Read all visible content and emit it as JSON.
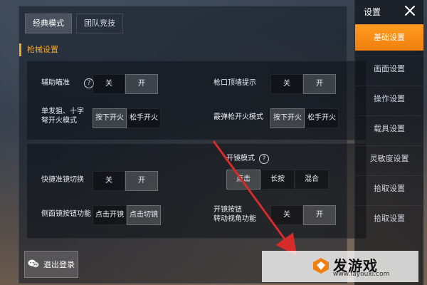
{
  "tabs": [
    {
      "label": "经典模式"
    },
    {
      "label": "团队竞技"
    }
  ],
  "section": {
    "title": "枪械设置"
  },
  "panel1": {
    "rows": [
      {
        "label": "辅助瞄准",
        "options": [
          "关",
          "开"
        ]
      },
      {
        "label": "枪口顶墙提示",
        "options": [
          "关",
          "开"
        ]
      },
      {
        "label": "单发狙、十字\n弩开火模式",
        "options": [
          "按下开火",
          "松手开火"
        ]
      },
      {
        "label": "霰弹枪开火模式",
        "options": [
          "按下开火",
          "松手开火"
        ]
      }
    ]
  },
  "panel2": {
    "rows": [
      {
        "label": "快捷准镜切换",
        "options": [
          "关",
          "开"
        ]
      },
      {
        "label": "开镜模式",
        "options": [
          "点击",
          "长按",
          "混合"
        ]
      },
      {
        "label": "侧面镜按钮功能",
        "options": [
          "点击开镜",
          "点击切镜"
        ]
      },
      {
        "label": "开镜按钮\n转动视角功能",
        "options": [
          "关",
          "开"
        ]
      }
    ]
  },
  "sidebar": {
    "title": "设置",
    "items": [
      {
        "label": "基础设置"
      },
      {
        "label": "画面设置"
      },
      {
        "label": "操作设置"
      },
      {
        "label": "载具设置"
      },
      {
        "label": "灵敏度设置"
      },
      {
        "label": "拾取设置"
      },
      {
        "label": "拾取设置"
      }
    ]
  },
  "footer": {
    "logout_label": "退出登录"
  },
  "watermark": {
    "text": "发游戏",
    "url": "www.fayouxi.com"
  },
  "colors": {
    "accent": "#f5a623",
    "arrow": "#d62b2b"
  },
  "icons": {
    "close": "close-icon",
    "help": "help-icon",
    "wechat": "wechat-icon",
    "watermark_logo": "logo-icon"
  }
}
